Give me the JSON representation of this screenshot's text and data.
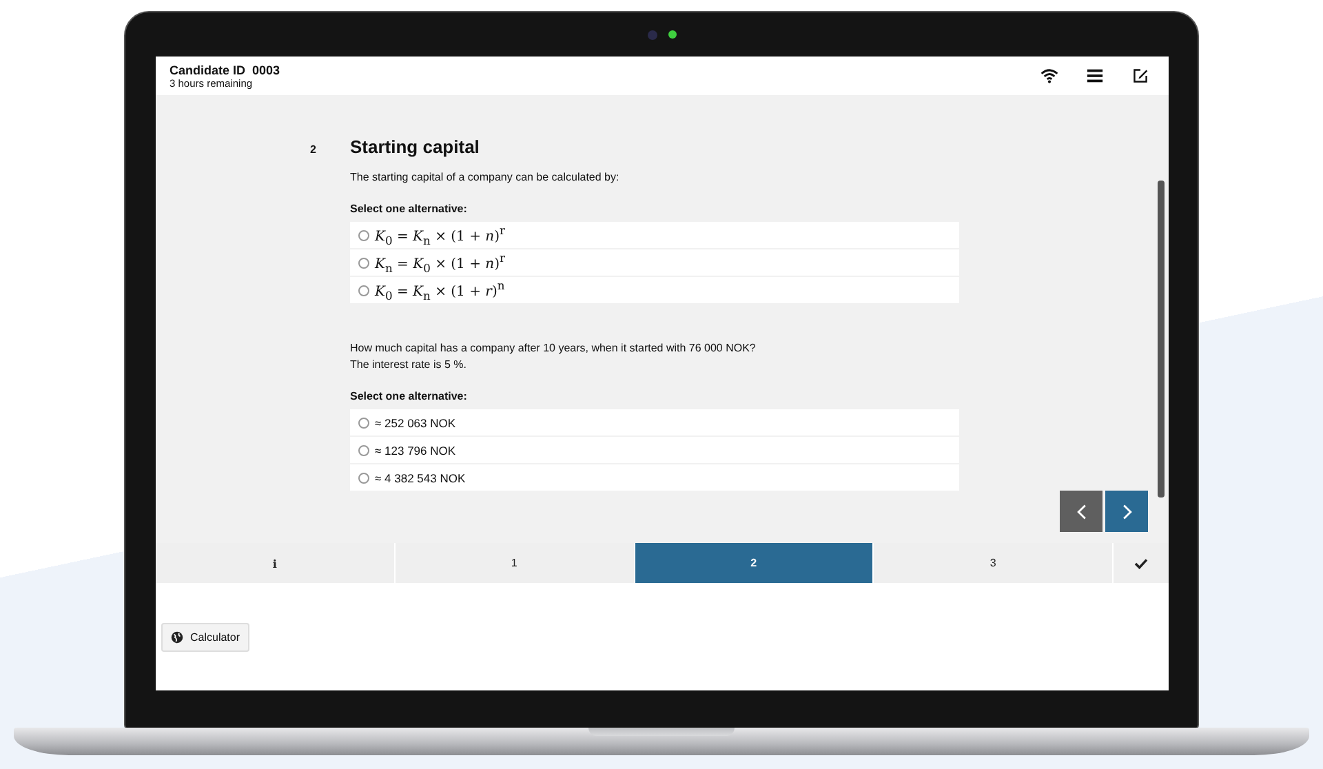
{
  "header": {
    "title": "Candidate ID  0003",
    "subtitle": "3 hours remaining"
  },
  "question": {
    "number": "2",
    "title": "Starting capital",
    "parts": [
      {
        "text": [
          "The starting capital of a company can be calculated by:"
        ],
        "prompt": "Select one alternative:",
        "options": [
          {
            "label": "*K*$_{0}$ = *K*$_{n}$ × (1 + *n*)$^{r}$",
            "selected": false
          },
          {
            "label": "*K*$_{n}$ = *K*$_{0}$ × (1 + *n*)$^{r}$",
            "selected": false
          },
          {
            "label": "*K*$_{0}$ = *K*$_{n}$ × (1 + *r*)$^{n}$",
            "selected": false
          }
        ]
      },
      {
        "text": [
          "How much capital has a company after 10 years, when it started with 76 000 NOK?",
          "The interest rate is 5 %."
        ],
        "prompt": "Select one alternative:",
        "options": [
          {
            "label": "≈ 252 063 NOK",
            "selected": false
          },
          {
            "label": "≈ 123 796 NOK",
            "selected": false
          },
          {
            "label": "≈ 4 382 543 NOK",
            "selected": false
          }
        ]
      }
    ]
  },
  "tabs": [
    {
      "label": "i",
      "kind": "info",
      "selected": false
    },
    {
      "label": "1",
      "kind": "question",
      "selected": false
    },
    {
      "label": "2",
      "kind": "question",
      "selected": true
    },
    {
      "label": "3",
      "kind": "question",
      "selected": false
    }
  ],
  "tools": [
    {
      "label": "Calculator"
    }
  ]
}
